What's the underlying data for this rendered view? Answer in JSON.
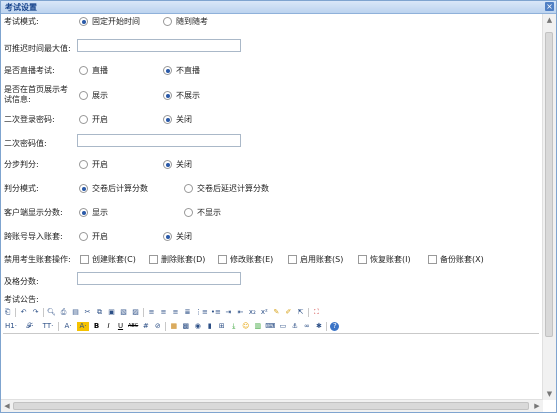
{
  "window": {
    "title": "考试设置",
    "close_icon": "close-icon"
  },
  "form": {
    "exam_mode": {
      "label": "考试模式:",
      "options": [
        "固定开始时间",
        "随到随考"
      ],
      "selected": 0
    },
    "max_delay": {
      "label": "可推迟时间最大值:",
      "value": ""
    },
    "live": {
      "label": "是否直播考试:",
      "options": [
        "直播",
        "不直播"
      ],
      "selected": 1
    },
    "homepage": {
      "label_line1": "是否在首页展示考",
      "label_line2": "试信息:",
      "options": [
        "展示",
        "不展示"
      ],
      "selected": 1
    },
    "second_pwd": {
      "label": "二次登录密码:",
      "options": [
        "开启",
        "关闭"
      ],
      "selected": 1
    },
    "second_pwd_value": {
      "label": "二次密码值:",
      "value": ""
    },
    "step_score": {
      "label": "分步判分:",
      "options": [
        "开启",
        "关闭"
      ],
      "selected": 1
    },
    "grading_mode": {
      "label": "判分模式:",
      "options": [
        "交卷后计算分数",
        "交卷后延迟计算分数"
      ],
      "selected": 0
    },
    "client_score": {
      "label": "客户端显示分数:",
      "options": [
        "显示",
        "不显示"
      ],
      "selected": 0
    },
    "cross_import": {
      "label": "跨账号导入账套:",
      "options": [
        "开启",
        "关闭"
      ],
      "selected": 1
    },
    "disabled_ops": {
      "label": "禁用考生账套操作:",
      "options": [
        "创建账套(C)",
        "删除账套(D)",
        "修改账套(E)",
        "启用账套(S)",
        "恢复账套(I)",
        "备份账套(X)"
      ]
    },
    "pass_score": {
      "label": "及格分数:",
      "value": ""
    },
    "announcement": {
      "label": "考试公告:"
    }
  },
  "editor_toolbar": {
    "row1": [
      "source",
      "undo",
      "redo",
      "preview",
      "print",
      "template",
      "cut",
      "copy",
      "paste",
      "paste-text",
      "paste-word",
      "align-left",
      "align-center",
      "align-right",
      "align-justify",
      "ordered-list",
      "unordered-list",
      "indent",
      "outdent",
      "subscript",
      "superscript",
      "clear-format",
      "select-all",
      "fullscreen-maximize",
      "remove-format"
    ],
    "row2_labels": {
      "heading": "H1·",
      "font": "𝓕·",
      "size": "TT·",
      "forecolor": "A·",
      "hilite": "A·",
      "bold": "B",
      "italic": "I",
      "underline": "U",
      "strike": "ABC"
    },
    "row2_icons": [
      "hr",
      "image",
      "flash",
      "media",
      "table",
      "emotion",
      "map",
      "link",
      "anchor",
      "unlink",
      "special-char",
      "about"
    ]
  },
  "colors": {
    "accent": "#15428b",
    "title_bg": "#c9dcf3",
    "hilite_bg": "#f5c200"
  }
}
